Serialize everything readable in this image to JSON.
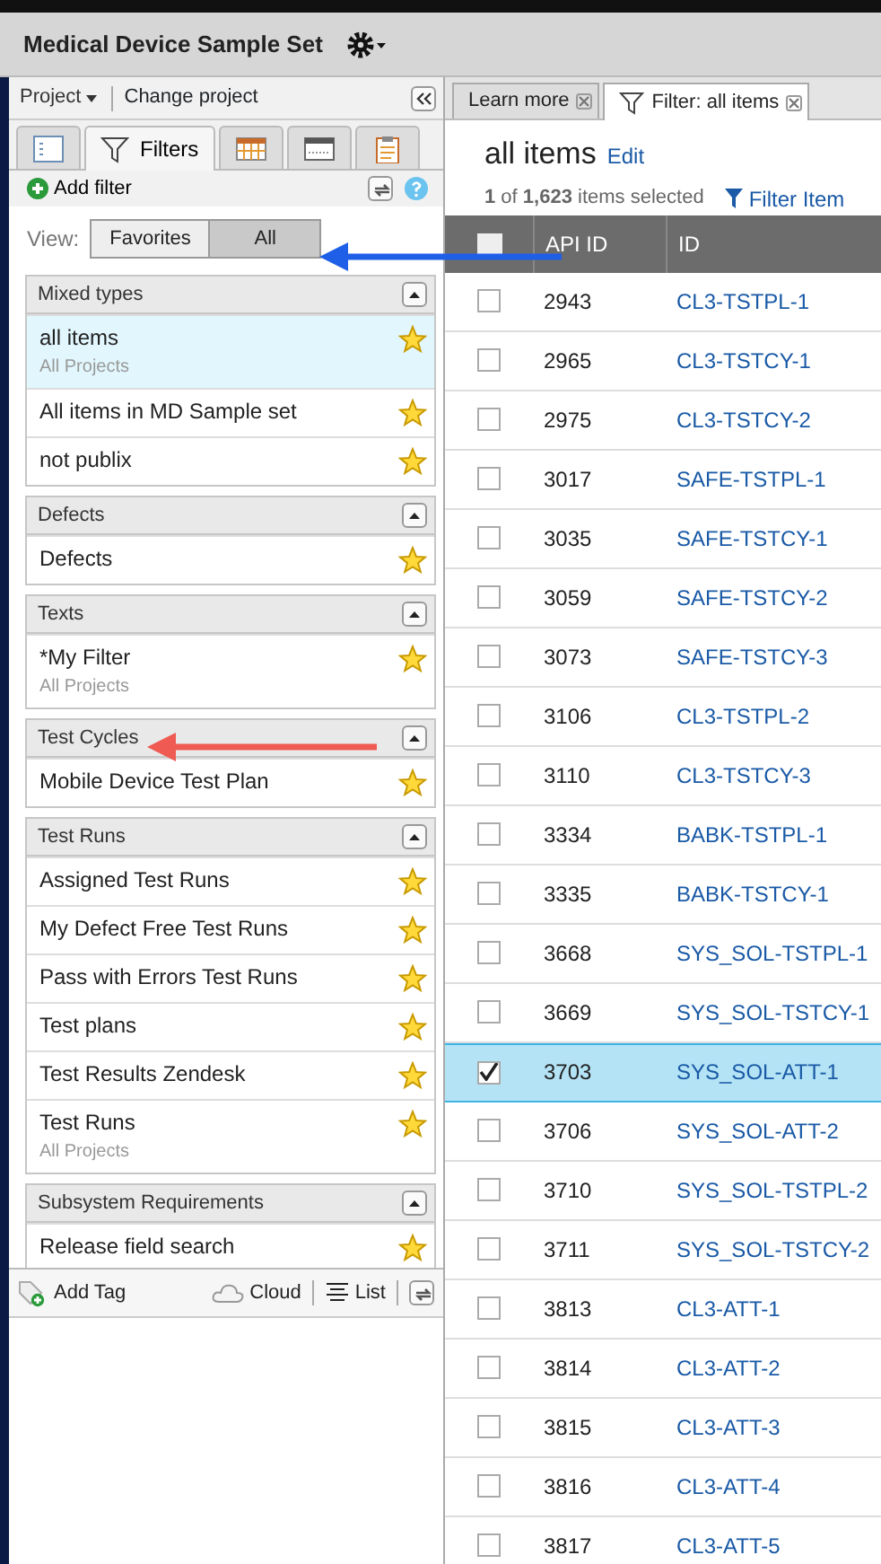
{
  "header": {
    "title": "Medical Device Sample Set"
  },
  "project_bar": {
    "project_menu": "Project",
    "change_project": "Change project"
  },
  "left_tabs": [
    {
      "kind": "tree",
      "selected": false
    },
    {
      "kind": "filters",
      "label": "Filters",
      "selected": true
    },
    {
      "kind": "grid",
      "selected": false
    },
    {
      "kind": "window",
      "selected": false
    },
    {
      "kind": "clipboard",
      "selected": false
    }
  ],
  "add_filter": "Add filter",
  "view": {
    "label": "View:",
    "options": [
      {
        "label": "Favorites",
        "selected": false
      },
      {
        "label": "All",
        "selected": true
      }
    ]
  },
  "filter_groups": [
    {
      "title": "Mixed types",
      "filters": [
        {
          "name": "all items",
          "scope": "All Projects",
          "selected": true
        },
        {
          "name": "All items in MD Sample set",
          "selected": false
        },
        {
          "name": "not publix",
          "selected": false
        }
      ]
    },
    {
      "title": "Defects",
      "filters": [
        {
          "name": "Defects",
          "selected": false
        }
      ]
    },
    {
      "title": "Texts",
      "filters": [
        {
          "name": "*My Filter",
          "scope": "All Projects",
          "selected": false
        }
      ]
    },
    {
      "title": "Test Cycles",
      "filters": [
        {
          "name": "Mobile Device Test Plan",
          "selected": false
        }
      ]
    },
    {
      "title": "Test Runs",
      "filters": [
        {
          "name": "Assigned Test Runs",
          "selected": false
        },
        {
          "name": "My Defect Free Test Runs",
          "selected": false
        },
        {
          "name": "Pass with Errors Test Runs",
          "selected": false
        },
        {
          "name": "Test plans",
          "selected": false
        },
        {
          "name": "Test Results Zendesk",
          "selected": false
        },
        {
          "name": "Test Runs",
          "scope": "All Projects",
          "selected": false
        }
      ]
    },
    {
      "title": "Subsystem Requirements",
      "filters": [
        {
          "name": "Release field search",
          "selected": false
        }
      ]
    }
  ],
  "tag_bar": {
    "add_tag": "Add Tag",
    "cloud": "Cloud",
    "list": "List"
  },
  "doc_tabs": [
    {
      "label": "Learn more",
      "kind": "plain",
      "selected": false
    },
    {
      "label": "Filter: all items",
      "kind": "filter",
      "selected": true
    }
  ],
  "result": {
    "title": "all items",
    "edit": "Edit",
    "summary": "**1** of **1,623** items selected",
    "filter_link": "Filter Item"
  },
  "table": {
    "select_all": {
      "checked": false
    },
    "columns": [
      "API ID",
      "ID"
    ],
    "rows": [
      {
        "api_id": "2943",
        "id": "CL3-TSTPL-1",
        "selected": false
      },
      {
        "api_id": "2965",
        "id": "CL3-TSTCY-1",
        "selected": false
      },
      {
        "api_id": "2975",
        "id": "CL3-TSTCY-2",
        "selected": false
      },
      {
        "api_id": "3017",
        "id": "SAFE-TSTPL-1",
        "selected": false
      },
      {
        "api_id": "3035",
        "id": "SAFE-TSTCY-1",
        "selected": false
      },
      {
        "api_id": "3059",
        "id": "SAFE-TSTCY-2",
        "selected": false
      },
      {
        "api_id": "3073",
        "id": "SAFE-TSTCY-3",
        "selected": false
      },
      {
        "api_id": "3106",
        "id": "CL3-TSTPL-2",
        "selected": false
      },
      {
        "api_id": "3110",
        "id": "CL3-TSTCY-3",
        "selected": false
      },
      {
        "api_id": "3334",
        "id": "BABK-TSTPL-1",
        "selected": false
      },
      {
        "api_id": "3335",
        "id": "BABK-TSTCY-1",
        "selected": false
      },
      {
        "api_id": "3668",
        "id": "SYS_SOL-TSTPL-1",
        "selected": false
      },
      {
        "api_id": "3669",
        "id": "SYS_SOL-TSTCY-1",
        "selected": false
      },
      {
        "api_id": "3703",
        "id": "SYS_SOL-ATT-1",
        "selected": true
      },
      {
        "api_id": "3706",
        "id": "SYS_SOL-ATT-2",
        "selected": false
      },
      {
        "api_id": "3710",
        "id": "SYS_SOL-TSTPL-2",
        "selected": false
      },
      {
        "api_id": "3711",
        "id": "SYS_SOL-TSTCY-2",
        "selected": false
      },
      {
        "api_id": "3813",
        "id": "CL3-ATT-1",
        "selected": false
      },
      {
        "api_id": "3814",
        "id": "CL3-ATT-2",
        "selected": false
      },
      {
        "api_id": "3815",
        "id": "CL3-ATT-3",
        "selected": false
      },
      {
        "api_id": "3816",
        "id": "CL3-ATT-4",
        "selected": false
      },
      {
        "api_id": "3817",
        "id": "CL3-ATT-5",
        "selected": false
      }
    ]
  },
  "annotations": [
    {
      "kind": "arrow",
      "color": "#1f5fe8"
    },
    {
      "kind": "arrow",
      "color": "#ef5a52"
    }
  ]
}
